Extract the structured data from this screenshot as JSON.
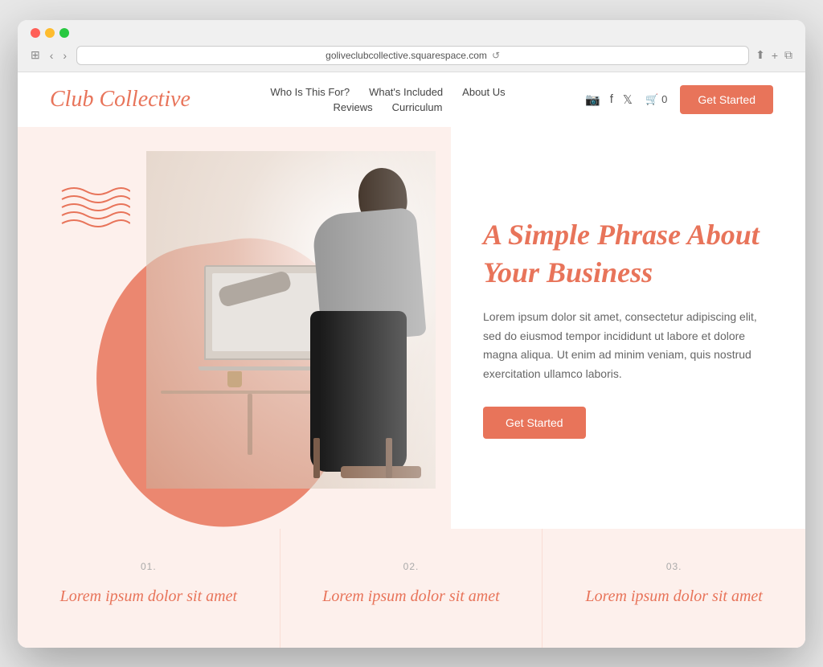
{
  "browser": {
    "url": "goliveclubcollective.squarespace.com",
    "nav_back": "‹",
    "nav_forward": "›",
    "reload": "↺",
    "share": "⬆",
    "new_tab": "+",
    "copy": "⧉",
    "sidebar": "⊞"
  },
  "nav": {
    "logo": "Club Collective",
    "links_row1": [
      {
        "label": "Who Is This For?"
      },
      {
        "label": "What's Included"
      },
      {
        "label": "About Us"
      }
    ],
    "links_row2": [
      {
        "label": "Reviews"
      },
      {
        "label": "Curriculum"
      }
    ],
    "cart_count": "0",
    "cta": "Get Started"
  },
  "hero": {
    "headline": "A Simple Phrase About Your Business",
    "body": "Lorem ipsum dolor sit amet, consectetur adipiscing elit, sed do eiusmod tempor incididunt ut labore et dolore magna aliqua. Ut enim ad minim veniam, quis nostrud exercitation ullamco laboris.",
    "cta": "Get Started"
  },
  "features": [
    {
      "number": "01.",
      "title": "Lorem ipsum dolor sit amet"
    },
    {
      "number": "02.",
      "title": "Lorem ipsum dolor sit amet"
    },
    {
      "number": "03.",
      "title": "Lorem ipsum dolor sit amet"
    }
  ],
  "colors": {
    "brand": "#e8745a",
    "bg_light": "#fdf0ec",
    "text_dark": "#444",
    "text_muted": "#666"
  }
}
